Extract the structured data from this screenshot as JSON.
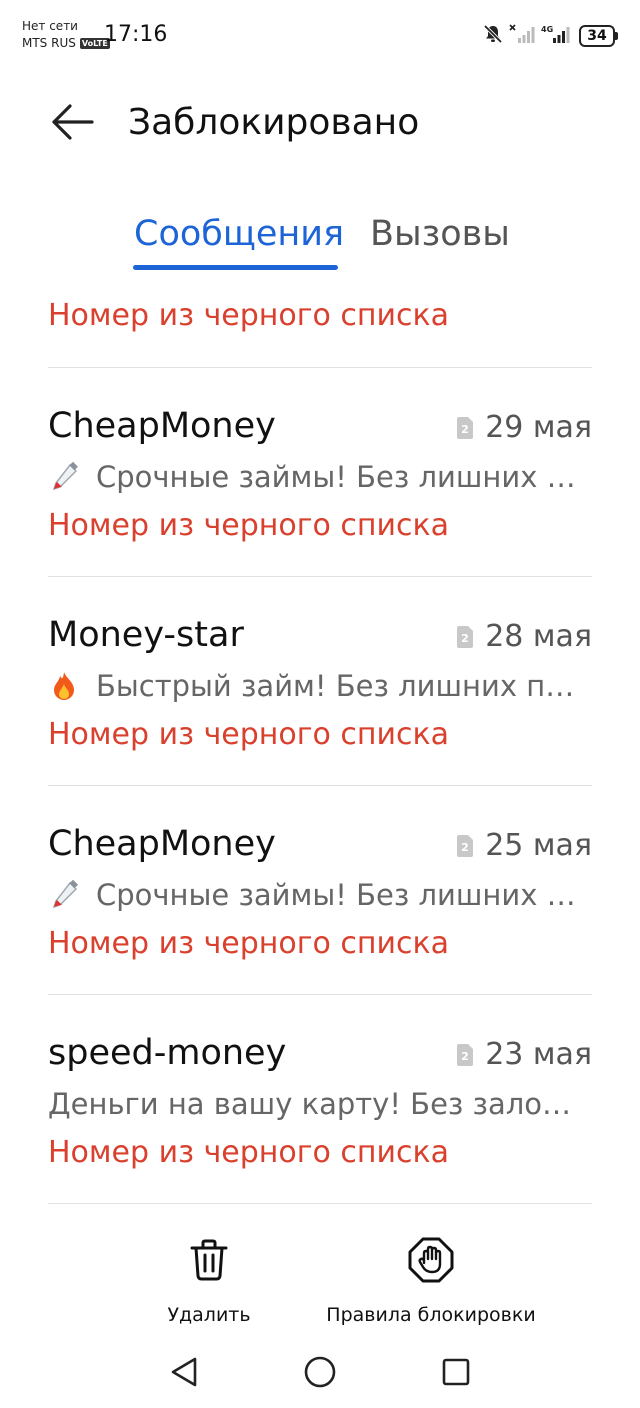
{
  "status_bar": {
    "carrier_line1": "Нет сети",
    "carrier_line2": "MTS RUS",
    "volte": "VoLTE",
    "time": "17:16",
    "network": "4G",
    "battery": "34"
  },
  "header": {
    "title": "Заблокировано"
  },
  "tabs": {
    "messages": "Сообщения",
    "calls": "Вызовы",
    "active": "messages"
  },
  "partial_item": {
    "blocked_label": "Номер из черного списка"
  },
  "messages": [
    {
      "sender": "CheapMoney",
      "sim": "2",
      "date": "29 мая",
      "preview_icon": "pipette-emoji",
      "preview": "Срочные займы! Без лишних …",
      "blocked_label": "Номер из черного списка"
    },
    {
      "sender": "Money-star",
      "sim": "2",
      "date": "28 мая",
      "preview_icon": "fire-emoji",
      "preview": "Быстрый займ! Без лишних п…",
      "blocked_label": "Номер из черного списка"
    },
    {
      "sender": "CheapMoney",
      "sim": "2",
      "date": "25 мая",
      "preview_icon": "pipette-emoji",
      "preview": "Срочные займы! Без лишних …",
      "blocked_label": "Номер из черного списка"
    },
    {
      "sender": "speed-money",
      "sim": "2",
      "date": "23 мая",
      "preview_icon": "",
      "preview": "Деньги на вашу карту! Без залог…",
      "blocked_label": "Номер из черного списка"
    }
  ],
  "actions": {
    "delete_label": "Удалить",
    "rules_label": "Правила блокировки"
  },
  "colors": {
    "accent": "#1d64d6",
    "blocked": "#d9412e",
    "divider": "#e2e2e2"
  }
}
